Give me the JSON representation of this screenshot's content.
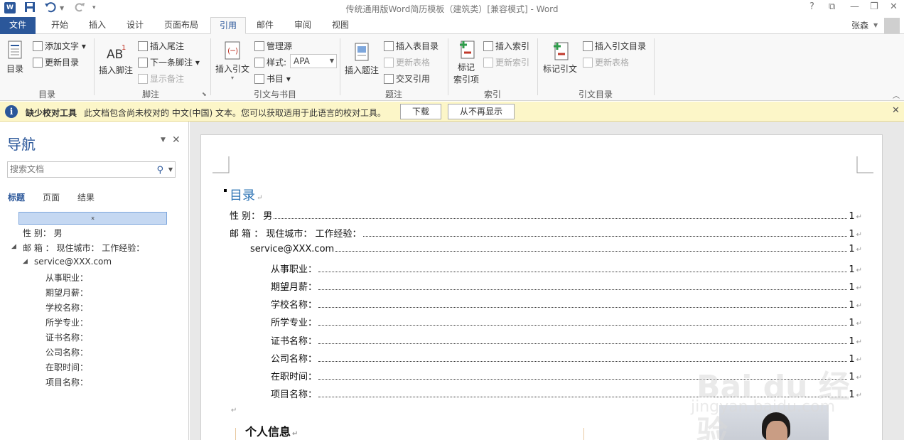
{
  "titlebar": {
    "title": "传统通用版Word简历模板（建筑类）[兼容模式] - Word",
    "help": "?",
    "restore_ribbon": "⧉",
    "minimize": "—",
    "maximize": "❐",
    "close": "✕"
  },
  "tabs": {
    "file": "文件",
    "items": [
      "开始",
      "插入",
      "设计",
      "页面布局",
      "引用",
      "邮件",
      "审阅",
      "视图"
    ],
    "user": "张森"
  },
  "ribbon": {
    "groups": {
      "toc": "目录",
      "footnotes": "脚注",
      "citations": "引文与书目",
      "captions": "题注",
      "index": "索引",
      "toa": "引文目录"
    },
    "toc_button": "目录",
    "add_text": "添加文字",
    "update_table": "更新目录",
    "insert_footnote": "插入脚注",
    "insert_endnote": "插入尾注",
    "next_footnote": "下一条脚注",
    "show_notes": "显示备注",
    "insert_citation": "插入引文",
    "manage_sources": "管理源",
    "style_label": "样式:",
    "style_value": "APA",
    "bibliography": "书目",
    "insert_caption": "插入题注",
    "insert_table_of_figures": "插入表目录",
    "update_figures_table": "更新表格",
    "cross_reference": "交叉引用",
    "mark_entry_line1": "标记",
    "mark_entry_line2": "索引项",
    "insert_index": "插入索引",
    "update_index": "更新索引",
    "mark_citation": "标记引文",
    "insert_toa": "插入引文目录",
    "update_toa": "更新表格"
  },
  "infobar": {
    "title": "缺少校对工具",
    "message": "此文档包含尚未校对的 中文(中国) 文本。您可以获取适用于此语言的校对工具。",
    "download": "下载",
    "dont_show": "从不再显示"
  },
  "nav": {
    "title": "导航",
    "search_placeholder": "搜索文档",
    "tabs": [
      "标题",
      "页面",
      "结果"
    ],
    "headings": [
      "性  别：  男",
      "邮    箱 ：  现住城市：  工作经验：",
      "service@XXX.com",
      "从事职业：",
      "期望月薪：",
      "学校名称：",
      "所学专业：",
      "证书名称：",
      "公司名称：",
      "在职时间：",
      "项目名称："
    ]
  },
  "document": {
    "toc_title": "目录",
    "toc": [
      {
        "text": "性        别：  男",
        "page": "1"
      },
      {
        "text": "邮    箱  ：  现住城市：  工作经验：",
        "page": "1"
      },
      {
        "text": "service@XXX.com",
        "page": "1"
      },
      {
        "text": "从事职业：",
        "page": "1"
      },
      {
        "text": "期望月薪：",
        "page": "1"
      },
      {
        "text": "学校名称：",
        "page": "1"
      },
      {
        "text": "所学专业：",
        "page": "1"
      },
      {
        "text": "证书名称：",
        "page": "1"
      },
      {
        "text": "公司名称：",
        "page": "1"
      },
      {
        "text": "在职时间：",
        "page": "1"
      },
      {
        "text": "项目名称：",
        "page": "1"
      }
    ],
    "para_mark": "↵",
    "section_heading": "个人信息"
  },
  "watermark": {
    "line1": "Bai du 经验",
    "line2": "jingyan.baidu.com"
  },
  "colors": {
    "accent": "#2b579a",
    "infobar": "#fcf6c8",
    "toc_title": "#2e74b5"
  }
}
